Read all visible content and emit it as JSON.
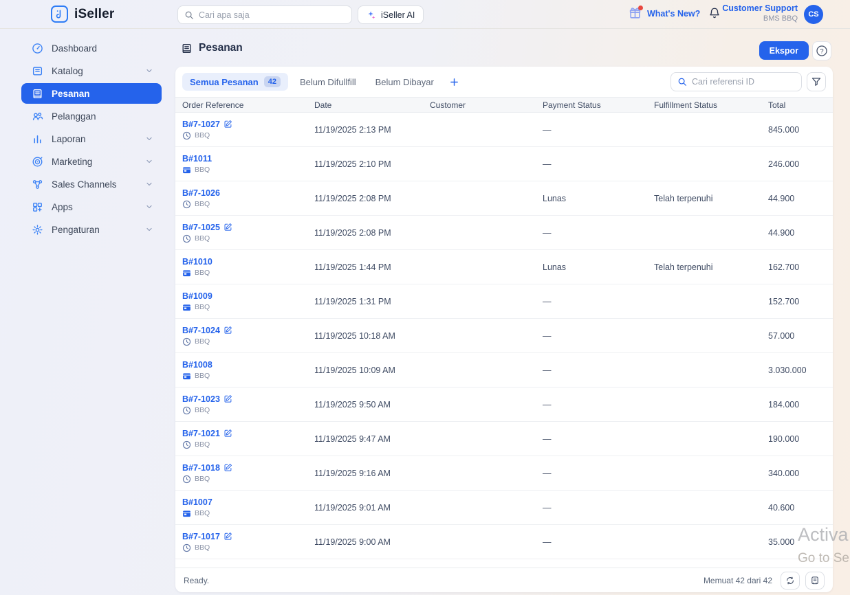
{
  "topbar": {
    "brand": "iSeller",
    "search_placeholder": "Cari apa saja",
    "ai_button_label": "iSeller AI",
    "whats_new_label": "What's New?",
    "account_name": "Customer Support",
    "account_store": "BMS BBQ",
    "avatar_initials": "CS"
  },
  "sidebar": {
    "items": [
      {
        "label": "Dashboard",
        "icon": "gauge",
        "active": false,
        "expandable": false
      },
      {
        "label": "Katalog",
        "icon": "book",
        "active": false,
        "expandable": true
      },
      {
        "label": "Pesanan",
        "icon": "receipt",
        "active": true,
        "expandable": false
      },
      {
        "label": "Pelanggan",
        "icon": "users",
        "active": false,
        "expandable": false
      },
      {
        "label": "Laporan",
        "icon": "chart",
        "active": false,
        "expandable": true
      },
      {
        "label": "Marketing",
        "icon": "target",
        "active": false,
        "expandable": true
      },
      {
        "label": "Sales Channels",
        "icon": "network",
        "active": false,
        "expandable": true
      },
      {
        "label": "Apps",
        "icon": "apps",
        "active": false,
        "expandable": true
      },
      {
        "label": "Pengaturan",
        "icon": "gear",
        "active": false,
        "expandable": true
      }
    ]
  },
  "page": {
    "title": "Pesanan",
    "export_button_label": "Ekspor",
    "tabs": [
      {
        "label": "Semua Pesanan",
        "badge": "42",
        "active": true
      },
      {
        "label": "Belum Difullfill",
        "badge": "",
        "active": false
      },
      {
        "label": "Belum Dibayar",
        "badge": "",
        "active": false
      }
    ],
    "table_search_placeholder": "Cari referensi ID"
  },
  "table": {
    "columns": [
      "Order Reference",
      "Date",
      "Customer",
      "Payment Status",
      "Fulfillment Status",
      "Total"
    ],
    "rows": [
      {
        "ref": "B#7-1027",
        "editable": true,
        "channel_type": "draft",
        "channel": "BBQ",
        "date": "11/19/2025 2:13 PM",
        "customer": "",
        "payment": "—",
        "fulfillment": "",
        "total": "845.000"
      },
      {
        "ref": "B#1011",
        "editable": false,
        "channel_type": "pos",
        "channel": "BBQ",
        "date": "11/19/2025 2:10 PM",
        "customer": "",
        "payment": "—",
        "fulfillment": "",
        "total": "246.000"
      },
      {
        "ref": "B#7-1026",
        "editable": false,
        "channel_type": "draft",
        "channel": "BBQ",
        "date": "11/19/2025 2:08 PM",
        "customer": "",
        "payment": "Lunas",
        "fulfillment": "Telah terpenuhi",
        "total": "44.900"
      },
      {
        "ref": "B#7-1025",
        "editable": true,
        "channel_type": "draft",
        "channel": "BBQ",
        "date": "11/19/2025 2:08 PM",
        "customer": "",
        "payment": "—",
        "fulfillment": "",
        "total": "44.900"
      },
      {
        "ref": "B#1010",
        "editable": false,
        "channel_type": "pos",
        "channel": "BBQ",
        "date": "11/19/2025 1:44 PM",
        "customer": "",
        "payment": "Lunas",
        "fulfillment": "Telah terpenuhi",
        "total": "162.700"
      },
      {
        "ref": "B#1009",
        "editable": false,
        "channel_type": "pos",
        "channel": "BBQ",
        "date": "11/19/2025 1:31 PM",
        "customer": "",
        "payment": "—",
        "fulfillment": "",
        "total": "152.700"
      },
      {
        "ref": "B#7-1024",
        "editable": true,
        "channel_type": "draft",
        "channel": "BBQ",
        "date": "11/19/2025 10:18 AM",
        "customer": "",
        "payment": "—",
        "fulfillment": "",
        "total": "57.000"
      },
      {
        "ref": "B#1008",
        "editable": false,
        "channel_type": "pos",
        "channel": "BBQ",
        "date": "11/19/2025 10:09 AM",
        "customer": "",
        "payment": "—",
        "fulfillment": "",
        "total": "3.030.000"
      },
      {
        "ref": "B#7-1023",
        "editable": true,
        "channel_type": "draft",
        "channel": "BBQ",
        "date": "11/19/2025 9:50 AM",
        "customer": "",
        "payment": "—",
        "fulfillment": "",
        "total": "184.000"
      },
      {
        "ref": "B#7-1021",
        "editable": true,
        "channel_type": "draft",
        "channel": "BBQ",
        "date": "11/19/2025 9:47 AM",
        "customer": "",
        "payment": "—",
        "fulfillment": "",
        "total": "190.000"
      },
      {
        "ref": "B#7-1018",
        "editable": true,
        "channel_type": "draft",
        "channel": "BBQ",
        "date": "11/19/2025 9:16 AM",
        "customer": "",
        "payment": "—",
        "fulfillment": "",
        "total": "340.000"
      },
      {
        "ref": "B#1007",
        "editable": false,
        "channel_type": "pos",
        "channel": "BBQ",
        "date": "11/19/2025 9:01 AM",
        "customer": "",
        "payment": "—",
        "fulfillment": "",
        "total": "40.600"
      },
      {
        "ref": "B#7-1017",
        "editable": true,
        "channel_type": "draft",
        "channel": "BBQ",
        "date": "11/19/2025 9:00 AM",
        "customer": "",
        "payment": "—",
        "fulfillment": "",
        "total": "35.000"
      }
    ]
  },
  "footer": {
    "status": "Ready.",
    "load_count": "Memuat 42 dari 42"
  },
  "watermark": {
    "line1": "Activa",
    "line2": "Go to Se"
  },
  "colors": {
    "accent": "#2563eb",
    "accent_light": "#e9effc",
    "badge_bg": "#c9d5f1",
    "link": "#2563eb",
    "text_dark": "#25304a",
    "text_muted": "#8a92a6",
    "avatar_bg": "#2563eb",
    "notification_dot": "#e8483f"
  }
}
